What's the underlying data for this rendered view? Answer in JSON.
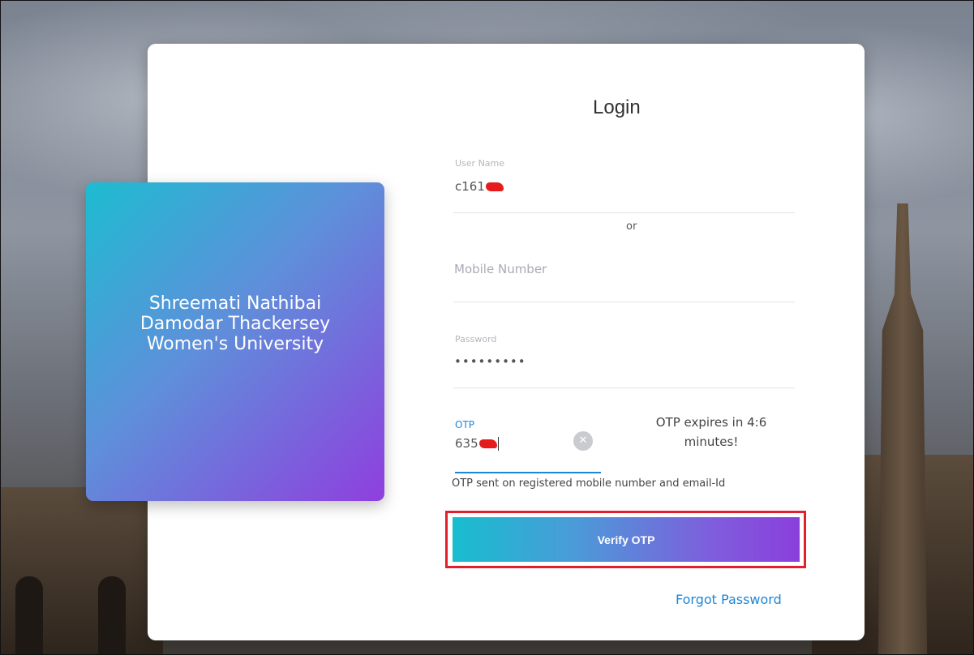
{
  "brand": {
    "name": "Shreemati Nathibai Damodar Thackersey Women's University"
  },
  "login": {
    "title": "Login",
    "username": {
      "label": "User Name",
      "value": "c161"
    },
    "or_text": "or",
    "mobile": {
      "placeholder": "Mobile Number"
    },
    "password": {
      "label": "Password",
      "value": "•••••••••"
    },
    "otp": {
      "label": "OTP",
      "value": "635",
      "expiry_message": "OTP expires in 4:6 minutes!",
      "sent_message": "OTP sent on registered mobile number and email-Id"
    },
    "verify_button": "Verify OTP",
    "forgot_link": "Forgot Password"
  },
  "colors": {
    "accent_blue": "#1e86d6",
    "gradient_start": "#17bdcf",
    "gradient_end": "#8a3fdc",
    "highlight_red": "#e21f2c"
  },
  "icons": {
    "clear": "clear-x-icon"
  }
}
